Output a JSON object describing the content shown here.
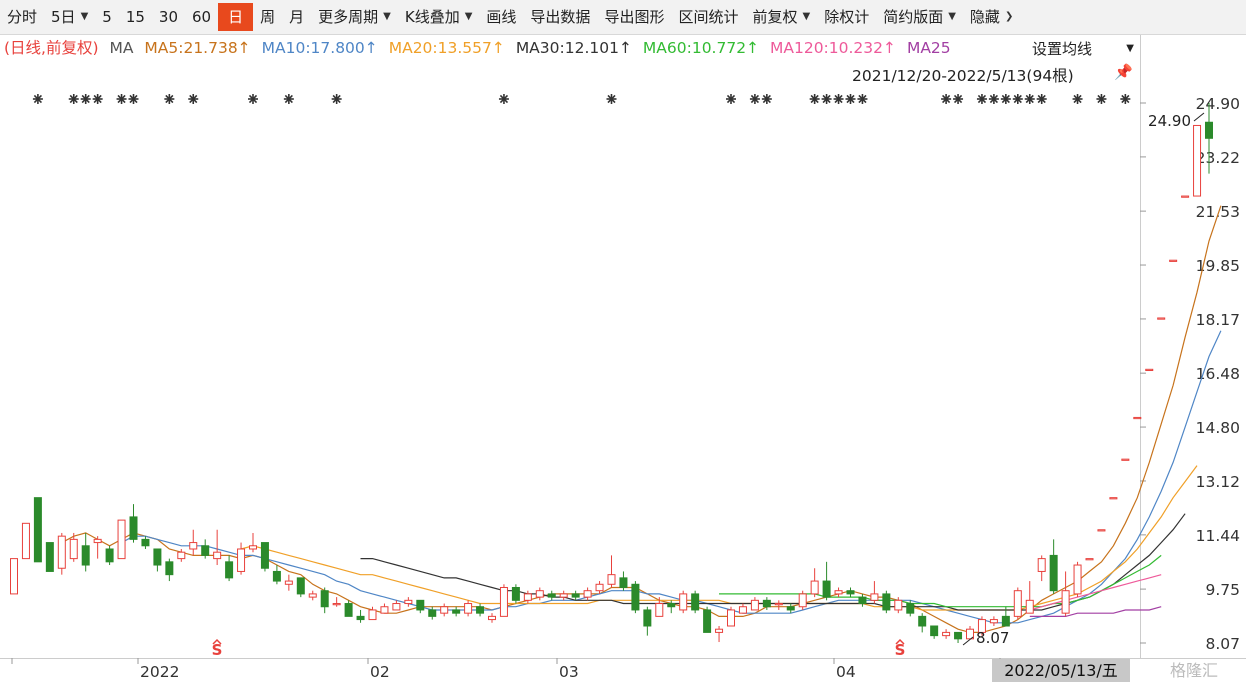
{
  "toolbar": {
    "items": [
      "分时",
      "5日",
      "5",
      "15",
      "30",
      "60",
      "日",
      "周",
      "月",
      "更多周期",
      "K线叠加",
      "画线",
      "导出数据",
      "导出图形",
      "区间统计",
      "前复权",
      "除权计",
      "简约版面",
      "隐藏"
    ],
    "active": "日"
  },
  "ma_legend": {
    "prefix": "(日线,前复权)",
    "ma_label": "MA",
    "ma5": "MA5:21.738↑",
    "ma10": "MA10:17.800↑",
    "ma20": "MA20:13.557↑",
    "ma30": "MA30:12.101↑",
    "ma60": "MA60:10.772↑",
    "ma120": "MA120:10.232↑",
    "ma250": "MA25",
    "settings_label": "设置均线"
  },
  "range_label": "2021/12/20-2022/5/13(94根)",
  "date_badge": "2022/05/13/五",
  "watermark": "格隆汇",
  "colors": {
    "up": "#e8413c",
    "down": "#2b8a2b",
    "ma5": "#c7731c",
    "ma10": "#4f86c6",
    "ma20": "#f0a028",
    "ma30": "#333333",
    "ma60": "#33bb33",
    "ma120": "#ee5a9a",
    "ma250": "#a23fa3"
  },
  "chart_data": {
    "type": "candlestick",
    "y_ticks": [
      "24.90",
      "23.22",
      "21.53",
      "19.85",
      "18.17",
      "16.48",
      "14.80",
      "13.12",
      "11.44",
      "9.75",
      "8.07"
    ],
    "ylim": [
      8.07,
      24.9
    ],
    "x_ticks": [
      "2022",
      "02",
      "03",
      "04"
    ],
    "annotations": {
      "high": "24.90",
      "low": "8.07",
      "marker": "S"
    },
    "candles": [
      [
        9.6,
        10.7,
        9.6,
        10.7
      ],
      [
        10.7,
        11.8,
        10.7,
        11.8
      ],
      [
        12.6,
        10.6,
        10.6,
        12.6
      ],
      [
        11.2,
        10.3,
        10.3,
        11.2
      ],
      [
        10.4,
        11.4,
        10.2,
        11.5
      ],
      [
        10.7,
        11.3,
        10.6,
        11.5
      ],
      [
        11.1,
        10.5,
        10.3,
        11.5
      ],
      [
        11.2,
        11.3,
        10.7,
        11.4
      ],
      [
        11.0,
        10.6,
        10.5,
        11.1
      ],
      [
        10.7,
        11.9,
        10.7,
        11.9
      ],
      [
        12.0,
        11.3,
        11.2,
        12.4
      ],
      [
        11.3,
        11.1,
        11.0,
        11.4
      ],
      [
        11.0,
        10.5,
        10.3,
        11.0
      ],
      [
        10.6,
        10.2,
        10.0,
        10.7
      ],
      [
        10.7,
        10.9,
        10.6,
        11.0
      ],
      [
        11.0,
        11.2,
        10.8,
        11.6
      ],
      [
        11.1,
        10.8,
        10.7,
        11.3
      ],
      [
        10.7,
        10.9,
        10.5,
        11.6
      ],
      [
        10.6,
        10.1,
        10.0,
        10.8
      ],
      [
        10.3,
        11.0,
        10.2,
        11.2
      ],
      [
        11.0,
        11.1,
        10.9,
        11.5
      ],
      [
        11.2,
        10.4,
        10.3,
        11.2
      ],
      [
        10.3,
        10.0,
        9.9,
        10.5
      ],
      [
        9.9,
        10.0,
        9.7,
        10.2
      ],
      [
        10.1,
        9.6,
        9.5,
        10.1
      ],
      [
        9.5,
        9.6,
        9.4,
        9.7
      ],
      [
        9.7,
        9.2,
        9.0,
        9.8
      ],
      [
        9.3,
        9.3,
        9.2,
        9.5
      ],
      [
        9.3,
        8.9,
        8.9,
        9.4
      ],
      [
        8.9,
        8.8,
        8.7,
        9.1
      ],
      [
        8.8,
        9.1,
        8.8,
        9.2
      ],
      [
        9.0,
        9.2,
        9.0,
        9.3
      ],
      [
        9.1,
        9.3,
        9.1,
        9.4
      ],
      [
        9.3,
        9.4,
        9.2,
        9.5
      ],
      [
        9.4,
        9.1,
        9.0,
        9.4
      ],
      [
        9.1,
        8.9,
        8.8,
        9.2
      ],
      [
        9.0,
        9.2,
        8.9,
        9.3
      ],
      [
        9.1,
        9.0,
        8.9,
        9.2
      ],
      [
        9.0,
        9.3,
        8.9,
        9.4
      ],
      [
        9.2,
        9.0,
        8.9,
        9.3
      ],
      [
        8.8,
        8.9,
        8.7,
        9.0
      ],
      [
        8.9,
        9.8,
        8.9,
        9.9
      ],
      [
        9.8,
        9.4,
        9.3,
        9.9
      ],
      [
        9.4,
        9.6,
        9.3,
        9.7
      ],
      [
        9.5,
        9.7,
        9.4,
        9.8
      ],
      [
        9.6,
        9.5,
        9.4,
        9.7
      ],
      [
        9.5,
        9.6,
        9.4,
        9.7
      ],
      [
        9.6,
        9.5,
        9.4,
        9.7
      ],
      [
        9.5,
        9.7,
        9.4,
        9.8
      ],
      [
        9.7,
        9.9,
        9.6,
        10.0
      ],
      [
        9.9,
        10.2,
        9.8,
        10.8
      ],
      [
        10.1,
        9.8,
        9.7,
        10.3
      ],
      [
        9.9,
        9.1,
        9.0,
        10.0
      ],
      [
        9.1,
        8.6,
        8.3,
        9.2
      ],
      [
        8.9,
        9.3,
        8.9,
        9.5
      ],
      [
        9.3,
        9.2,
        9.0,
        9.4
      ],
      [
        9.1,
        9.6,
        9.0,
        9.7
      ],
      [
        9.6,
        9.1,
        9.0,
        9.7
      ],
      [
        9.1,
        8.4,
        8.4,
        9.2
      ],
      [
        8.4,
        8.5,
        8.1,
        8.6
      ],
      [
        8.6,
        9.1,
        8.6,
        9.2
      ],
      [
        9.0,
        9.2,
        9.0,
        9.3
      ],
      [
        9.1,
        9.4,
        9.1,
        9.5
      ],
      [
        9.4,
        9.2,
        9.1,
        9.5
      ],
      [
        9.3,
        9.3,
        9.1,
        9.4
      ],
      [
        9.2,
        9.1,
        9.0,
        9.3
      ],
      [
        9.2,
        9.6,
        9.1,
        9.7
      ],
      [
        9.6,
        10.0,
        9.5,
        10.4
      ],
      [
        10.0,
        9.5,
        9.4,
        10.6
      ],
      [
        9.6,
        9.7,
        9.5,
        9.8
      ],
      [
        9.7,
        9.6,
        9.5,
        9.8
      ],
      [
        9.5,
        9.3,
        9.2,
        9.6
      ],
      [
        9.4,
        9.6,
        9.3,
        10.0
      ],
      [
        9.6,
        9.1,
        9.0,
        9.7
      ],
      [
        9.1,
        9.4,
        9.0,
        9.5
      ],
      [
        9.3,
        9.0,
        8.9,
        9.4
      ],
      [
        8.9,
        8.6,
        8.4,
        9.0
      ],
      [
        8.6,
        8.3,
        8.2,
        8.6
      ],
      [
        8.3,
        8.4,
        8.2,
        8.5
      ],
      [
        8.4,
        8.2,
        8.07,
        8.4
      ],
      [
        8.2,
        8.5,
        8.2,
        8.6
      ],
      [
        8.4,
        8.8,
        8.3,
        8.9
      ],
      [
        8.7,
        8.8,
        8.6,
        8.9
      ],
      [
        8.9,
        8.6,
        8.6,
        9.2
      ],
      [
        8.9,
        9.7,
        8.8,
        9.8
      ],
      [
        9.0,
        9.4,
        9.0,
        10.0
      ],
      [
        10.3,
        10.7,
        10.0,
        10.8
      ],
      [
        10.8,
        9.7,
        9.6,
        11.3
      ],
      [
        9.0,
        9.7,
        8.9,
        10.3
      ],
      [
        9.6,
        10.5,
        9.5,
        10.6
      ],
      [
        10.7,
        10.7,
        10.7,
        10.7
      ],
      [
        11.6,
        11.6,
        11.6,
        11.6
      ],
      [
        12.6,
        12.6,
        12.6,
        12.6
      ],
      [
        13.8,
        13.8,
        13.8,
        13.8
      ],
      [
        15.1,
        15.1,
        15.1,
        15.1
      ],
      [
        16.6,
        16.6,
        16.6,
        16.6
      ],
      [
        18.2,
        18.2,
        18.2,
        18.2
      ],
      [
        20.0,
        20.0,
        20.0,
        20.0
      ],
      [
        22.0,
        22.0,
        22.0,
        22.0
      ],
      [
        22.0,
        24.2,
        22.0,
        24.2
      ],
      [
        24.3,
        23.8,
        22.7,
        24.9
      ]
    ],
    "moving_averages": {
      "ma5": [
        null,
        null,
        null,
        null,
        11.2,
        11.4,
        11.5,
        11.3,
        11.1,
        11.3,
        11.5,
        11.4,
        11.3,
        11.0,
        10.9,
        10.8,
        10.8,
        10.8,
        10.8,
        10.7,
        10.8,
        10.7,
        10.5,
        10.3,
        10.2,
        9.9,
        9.7,
        9.6,
        9.4,
        9.2,
        9.1,
        9.0,
        9.0,
        9.1,
        9.2,
        9.2,
        9.2,
        9.2,
        9.2,
        9.2,
        9.1,
        9.2,
        9.3,
        9.4,
        9.5,
        9.6,
        9.6,
        9.6,
        9.6,
        9.6,
        9.8,
        9.8,
        9.8,
        9.6,
        9.4,
        9.3,
        9.2,
        9.2,
        9.1,
        8.9,
        8.9,
        8.9,
        9.0,
        9.2,
        9.2,
        9.2,
        9.3,
        9.4,
        9.5,
        9.6,
        9.7,
        9.6,
        9.5,
        9.5,
        9.4,
        9.3,
        9.1,
        8.9,
        8.7,
        8.5,
        8.4,
        8.4,
        8.5,
        8.6,
        8.8,
        9.1,
        9.4,
        9.6,
        9.8,
        10.0,
        10.3,
        10.6,
        11.1,
        11.8,
        12.6,
        13.7,
        14.9,
        16.1,
        17.6,
        19.0,
        20.6,
        21.7
      ],
      "ma10": [
        null,
        null,
        null,
        null,
        null,
        null,
        null,
        null,
        null,
        11.2,
        11.4,
        11.4,
        11.3,
        11.2,
        11.1,
        11.1,
        11.1,
        11.0,
        10.9,
        10.8,
        10.8,
        10.7,
        10.6,
        10.5,
        10.4,
        10.3,
        10.2,
        10.0,
        9.9,
        9.7,
        9.6,
        9.5,
        9.4,
        9.3,
        9.2,
        9.1,
        9.1,
        9.1,
        9.1,
        9.1,
        9.1,
        9.2,
        9.2,
        9.3,
        9.3,
        9.4,
        9.4,
        9.4,
        9.5,
        9.6,
        9.7,
        9.7,
        9.7,
        9.6,
        9.6,
        9.5,
        9.4,
        9.4,
        9.3,
        9.2,
        9.1,
        9.0,
        9.0,
        9.0,
        9.0,
        9.0,
        9.1,
        9.2,
        9.3,
        9.4,
        9.4,
        9.4,
        9.4,
        9.4,
        9.4,
        9.4,
        9.3,
        9.2,
        9.1,
        9.0,
        8.9,
        8.8,
        8.7,
        8.7,
        8.7,
        8.8,
        8.9,
        9.0,
        9.2,
        9.4,
        9.6,
        9.9,
        10.3,
        10.7,
        11.3,
        12.0,
        12.8,
        13.7,
        14.8,
        15.9,
        17.0,
        17.8
      ],
      "ma20": [
        null,
        null,
        null,
        null,
        null,
        null,
        null,
        null,
        null,
        null,
        null,
        null,
        null,
        null,
        null,
        null,
        null,
        null,
        null,
        11.0,
        11.1,
        11.0,
        10.9,
        10.8,
        10.7,
        10.6,
        10.5,
        10.4,
        10.3,
        10.2,
        10.2,
        10.1,
        10.0,
        9.9,
        9.8,
        9.7,
        9.6,
        9.5,
        9.4,
        9.3,
        9.3,
        9.3,
        9.3,
        9.3,
        9.3,
        9.3,
        9.3,
        9.3,
        9.3,
        9.4,
        9.4,
        9.4,
        9.4,
        9.4,
        9.4,
        9.4,
        9.4,
        9.4,
        9.4,
        9.4,
        9.3,
        9.3,
        9.3,
        9.3,
        9.3,
        9.3,
        9.3,
        9.3,
        9.3,
        9.3,
        9.3,
        9.3,
        9.2,
        9.2,
        9.2,
        9.2,
        9.1,
        9.1,
        9.1,
        9.1,
        9.1,
        9.1,
        9.1,
        9.1,
        9.1,
        9.2,
        9.3,
        9.4,
        9.5,
        9.6,
        9.8,
        10.0,
        10.3,
        10.6,
        11.0,
        11.5,
        12.0,
        12.6,
        13.1,
        13.6
      ],
      "ma30": [
        null,
        null,
        null,
        null,
        null,
        null,
        null,
        null,
        null,
        null,
        null,
        null,
        null,
        null,
        null,
        null,
        null,
        null,
        null,
        null,
        null,
        null,
        null,
        null,
        null,
        null,
        null,
        null,
        null,
        10.7,
        10.7,
        10.6,
        10.5,
        10.4,
        10.3,
        10.2,
        10.1,
        10.1,
        10.0,
        9.9,
        9.8,
        9.7,
        9.7,
        9.6,
        9.6,
        9.5,
        9.5,
        9.4,
        9.4,
        9.4,
        9.4,
        9.3,
        9.3,
        9.3,
        9.3,
        9.3,
        9.3,
        9.3,
        9.3,
        9.3,
        9.3,
        9.3,
        9.3,
        9.3,
        9.3,
        9.3,
        9.3,
        9.3,
        9.3,
        9.3,
        9.3,
        9.3,
        9.3,
        9.2,
        9.2,
        9.2,
        9.2,
        9.2,
        9.2,
        9.1,
        9.1,
        9.1,
        9.1,
        9.1,
        9.1,
        9.1,
        9.1,
        9.2,
        9.3,
        9.4,
        9.5,
        9.7,
        9.9,
        10.2,
        10.5,
        10.8,
        11.2,
        11.6,
        12.1
      ],
      "ma60": [
        null,
        null,
        null,
        null,
        null,
        null,
        null,
        null,
        null,
        null,
        null,
        null,
        null,
        null,
        null,
        null,
        null,
        null,
        null,
        null,
        null,
        null,
        null,
        null,
        null,
        null,
        null,
        null,
        null,
        null,
        null,
        null,
        null,
        null,
        null,
        null,
        null,
        null,
        null,
        null,
        null,
        null,
        null,
        null,
        null,
        null,
        null,
        null,
        null,
        null,
        null,
        null,
        null,
        null,
        null,
        null,
        null,
        null,
        null,
        9.6,
        9.6,
        9.6,
        9.6,
        9.6,
        9.6,
        9.6,
        9.6,
        9.6,
        9.5,
        9.5,
        9.5,
        9.5,
        9.4,
        9.4,
        9.4,
        9.3,
        9.3,
        9.3,
        9.2,
        9.2,
        9.2,
        9.2,
        9.2,
        9.2,
        9.2,
        9.2,
        9.2,
        9.3,
        9.3,
        9.4,
        9.5,
        9.7,
        9.9,
        10.1,
        10.3,
        10.5,
        10.8
      ],
      "ma120": [
        null,
        null,
        null,
        null,
        null,
        null,
        null,
        null,
        null,
        null,
        null,
        null,
        null,
        null,
        null,
        null,
        null,
        null,
        null,
        null,
        null,
        null,
        null,
        null,
        null,
        null,
        null,
        null,
        null,
        null,
        null,
        null,
        null,
        null,
        null,
        null,
        null,
        null,
        null,
        null,
        null,
        null,
        null,
        null,
        null,
        null,
        null,
        null,
        null,
        null,
        null,
        null,
        null,
        null,
        null,
        null,
        null,
        null,
        null,
        null,
        null,
        null,
        null,
        null,
        null,
        null,
        null,
        null,
        null,
        null,
        null,
        null,
        null,
        null,
        null,
        null,
        null,
        null,
        null,
        null,
        null,
        null,
        null,
        null,
        null,
        9.1,
        9.2,
        9.3,
        9.4,
        9.5,
        9.6,
        9.7,
        9.8,
        9.9,
        10.0,
        10.1,
        10.2
      ],
      "ma250": [
        null,
        null,
        null,
        null,
        null,
        null,
        null,
        null,
        null,
        null,
        null,
        null,
        null,
        null,
        null,
        null,
        null,
        null,
        null,
        null,
        null,
        null,
        null,
        null,
        null,
        null,
        null,
        null,
        null,
        null,
        null,
        null,
        null,
        null,
        null,
        null,
        null,
        null,
        null,
        null,
        null,
        null,
        null,
        null,
        null,
        null,
        null,
        null,
        null,
        null,
        null,
        null,
        null,
        null,
        null,
        null,
        null,
        null,
        null,
        null,
        null,
        null,
        null,
        null,
        null,
        null,
        null,
        null,
        null,
        null,
        null,
        null,
        null,
        null,
        null,
        null,
        null,
        null,
        null,
        null,
        null,
        null,
        null,
        null,
        null,
        8.9,
        8.9,
        8.9,
        8.9,
        9.0,
        9.0,
        9.0,
        9.0,
        9.1,
        9.1,
        9.1,
        9.2
      ]
    },
    "grid": false,
    "legend": "top"
  }
}
